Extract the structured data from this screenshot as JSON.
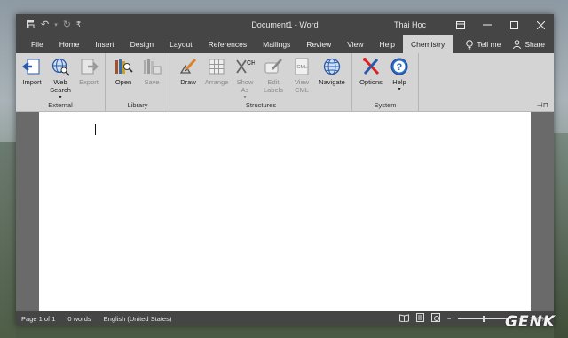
{
  "titlebar": {
    "title": "Document1 - Word",
    "user": "Thái Học",
    "qat": {
      "save_icon": "save-icon",
      "undo_icon": "undo-icon",
      "redo_icon": "redo-icon",
      "customize_icon": "customize-qat-icon"
    }
  },
  "tabs": [
    {
      "label": "File"
    },
    {
      "label": "Home"
    },
    {
      "label": "Insert"
    },
    {
      "label": "Design"
    },
    {
      "label": "Layout"
    },
    {
      "label": "References"
    },
    {
      "label": "Mailings"
    },
    {
      "label": "Review"
    },
    {
      "label": "View"
    },
    {
      "label": "Help"
    },
    {
      "label": "Chemistry"
    }
  ],
  "active_tab": "Chemistry",
  "tell_me": "Tell me",
  "share": "Share",
  "ribbon": {
    "external": {
      "label": "External",
      "import": "Import",
      "web_search_1": "Web",
      "web_search_2": "Search",
      "export": "Export"
    },
    "library": {
      "label": "Library",
      "open": "Open",
      "save": "Save"
    },
    "structures": {
      "label": "Structures",
      "draw": "Draw",
      "arrange": "Arrange",
      "show_as_1": "Show",
      "show_as_2": "As",
      "edit_labels_1": "Edit",
      "edit_labels_2": "Labels",
      "view_cml_1": "View",
      "view_cml_2": "CML",
      "navigate": "Navigate"
    },
    "system": {
      "label": "System",
      "options": "Options",
      "help": "Help"
    }
  },
  "status": {
    "page": "Page 1 of 1",
    "words": "0 words",
    "language": "English (United States)",
    "zoom": "100%"
  },
  "watermark": "GENK",
  "colors": {
    "title_bg": "#454545",
    "ribbon_bg": "#d4d4d4",
    "doc_bg": "#6a6a6a",
    "page_bg": "#ffffff"
  }
}
